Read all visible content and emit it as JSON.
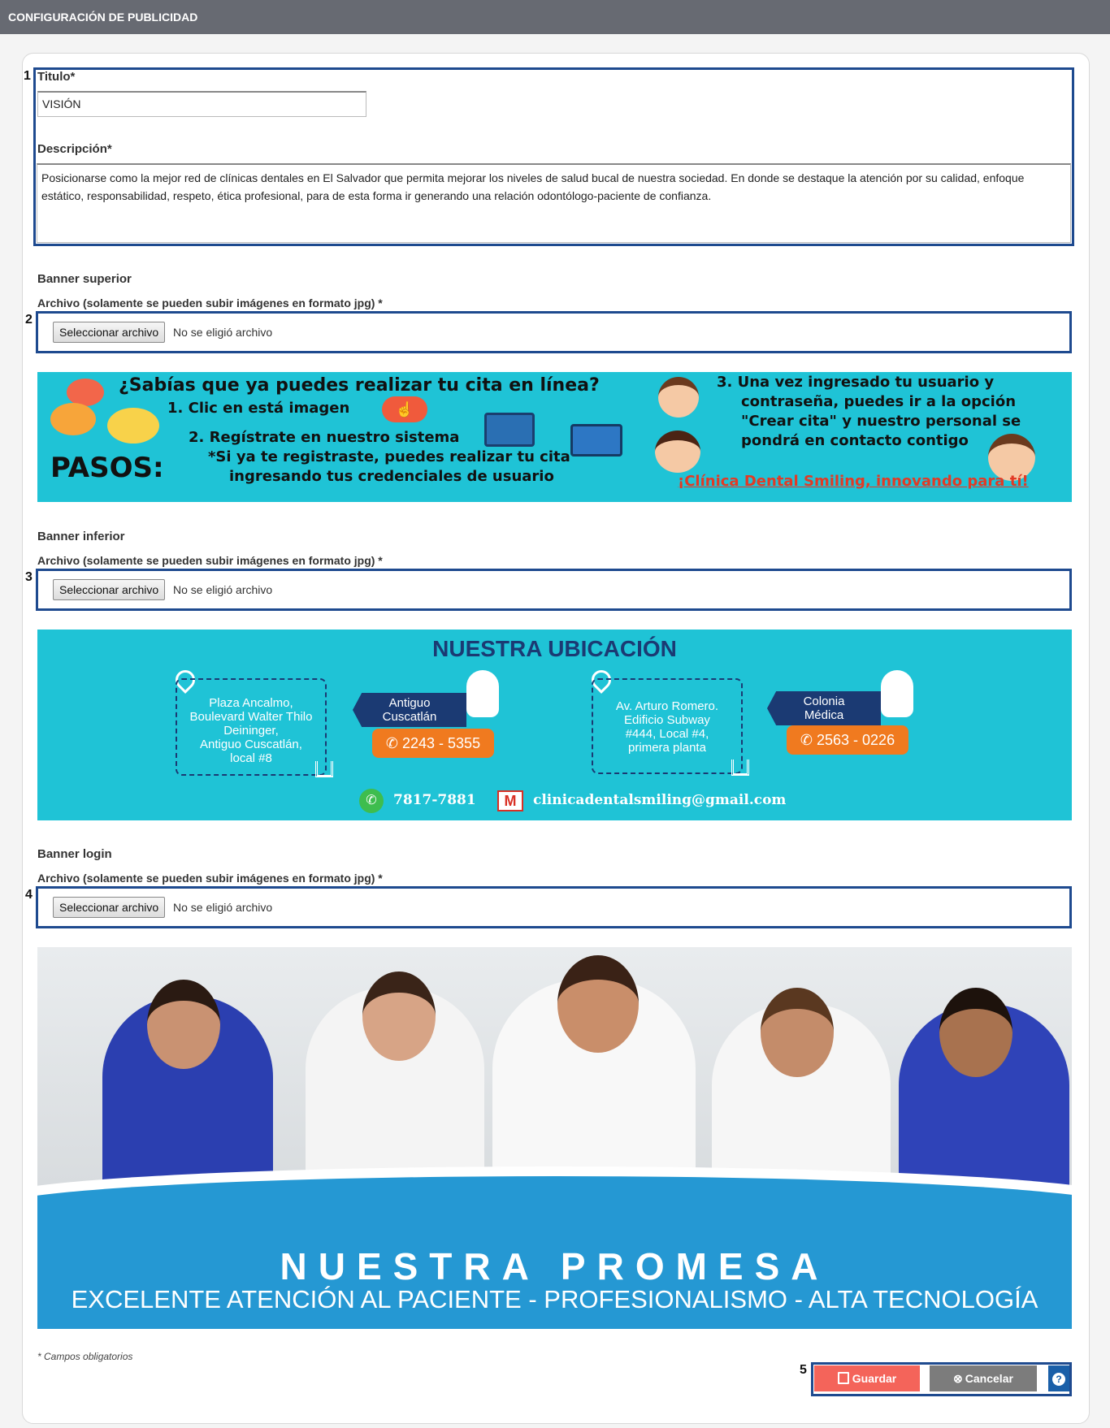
{
  "header": {
    "title": "CONFIGURACIÓN DE PUBLICIDAD"
  },
  "markers": [
    "1",
    "2",
    "3",
    "4",
    "5"
  ],
  "form": {
    "titulo_label": "Titulo*",
    "titulo_value": "VISIÓN",
    "descripcion_label": "Descripción*",
    "descripcion_value": "Posicionarse como la mejor red de clínicas dentales en El Salvador que permita mejorar los niveles de salud bucal de nuestra sociedad. En donde se destaque la atención por su calidad, enfoque estático, responsabilidad, respeto, ética profesional, para de esta forma ir generando una relación odontólogo-paciente de confianza."
  },
  "sections": [
    {
      "title": "Banner superior",
      "file_label": "Archivo (solamente se pueden subir imágenes en formato jpg) *",
      "button": "Seleccionar archivo",
      "status": "No se eligió archivo"
    },
    {
      "title": "Banner inferior",
      "file_label": "Archivo (solamente se pueden subir imágenes en formato jpg) *",
      "button": "Seleccionar archivo",
      "status": "No se eligió archivo"
    },
    {
      "title": "Banner login",
      "file_label": "Archivo (solamente se pueden subir imágenes en formato jpg) *",
      "button": "Seleccionar archivo",
      "status": "No se eligió archivo"
    }
  ],
  "banner_superior": {
    "headline": "¿Sabías que ya puedes realizar tu cita en línea?",
    "step1": "1. Clic en está imagen",
    "step2": "2. Regístrate en nuestro sistema",
    "note": "*Si ya te registraste, puedes realizar tu cita",
    "note2": "ingresando tus credenciales de usuario",
    "pasos": "PASOS:",
    "step3a": "3. Una vez ingresado tu usuario y",
    "step3b": "contraseña, puedes ir a la opción",
    "step3c": "\"Crear cita\" y nuestro personal se",
    "step3d": "pondrá en contacto contigo",
    "slogan": "¡Clínica Dental Smiling, innovando para tí!"
  },
  "banner_inferior": {
    "title": "NUESTRA UBICACIÓN",
    "loc1_address": [
      "Plaza Ancalmo,",
      "Boulevard Walter Thilo",
      "Deininger,",
      "Antiguo Cuscatlán,",
      "local #8"
    ],
    "loc1_name": [
      "Antiguo",
      "Cuscatlán"
    ],
    "loc1_phone": "2243 - 5355",
    "loc2_address": [
      "Av. Arturo Romero.",
      "Edificio Subway",
      "#444, Local #4,",
      "primera planta"
    ],
    "loc2_name": [
      "Colonia",
      "Médica"
    ],
    "loc2_phone": "2563 - 0226",
    "whatsapp": "7817-7881",
    "email": "clinicadentalsmiling@gmail.com"
  },
  "banner_login": {
    "title": "NUESTRA PROMESA",
    "subtitle": "EXCELENTE ATENCIÓN AL PACIENTE - PROFESIONALISMO - ALTA TECNOLOGÍA"
  },
  "footer": {
    "required_note": "* Campos obligatorios",
    "save": "Guardar",
    "cancel": "Cancelar",
    "help": "?"
  },
  "colors": {
    "header_bg": "#676a72",
    "highlight": "#1e4a8f",
    "save": "#f4645a",
    "cancel": "#7c7c7c",
    "help": "#1a5fa8",
    "banner_cyan": "#1fc3d6"
  }
}
